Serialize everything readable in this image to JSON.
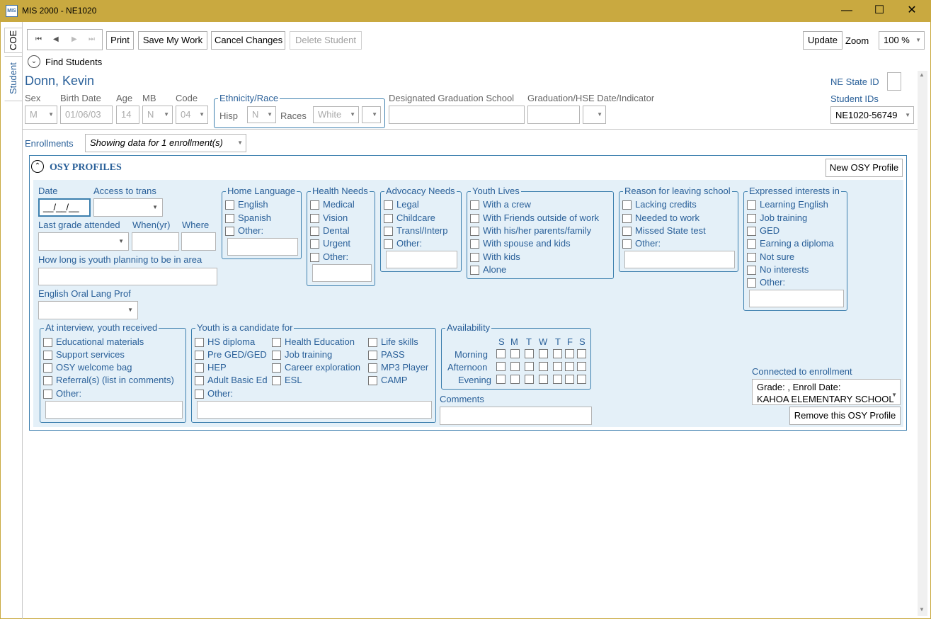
{
  "window": {
    "title": "MIS 2000 - NE1020",
    "app_icon_text": "MIS"
  },
  "side_tabs": [
    "COE",
    "Student"
  ],
  "toolbar": {
    "print": "Print",
    "save": "Save My Work",
    "cancel": "Cancel Changes",
    "delete": "Delete Student",
    "update": "Update",
    "zoom_label": "Zoom",
    "zoom_value": "100 %"
  },
  "find_students": "Find Students",
  "student": {
    "name": "Donn, Kevin",
    "labels": {
      "sex": "Sex",
      "birth_date": "Birth Date",
      "age": "Age",
      "mb": "MB",
      "code": "Code",
      "ethnicity": "Ethnicity/Race",
      "hisp": "Hisp",
      "races": "Races",
      "grad_school": "Designated Graduation School",
      "grad_date": "Graduation/HSE Date/Indicator",
      "ne_state_id": "NE State ID",
      "student_ids": "Student IDs"
    },
    "sex": "M",
    "birth_date": "01/06/03",
    "age": "14",
    "mb": "N",
    "code": "04",
    "hisp": "N",
    "race": "White",
    "student_id": "NE1020-56749"
  },
  "enrollments": {
    "label": "Enrollments",
    "value": "Showing data for 1 enrollment(s)"
  },
  "osy": {
    "title": "OSY PROFILES",
    "new_button": "New OSY Profile",
    "remove_button": "Remove this OSY Profile",
    "date_label": "Date",
    "date_value": "__/__/__",
    "access_label": "Access to trans",
    "last_grade_label": "Last grade attended",
    "when_label": "When(yr)",
    "where_label": "Where",
    "how_long_label": "How long is youth planning to be in area",
    "english_prof_label": "English Oral Lang Prof",
    "home_language": {
      "title": "Home Language",
      "items": [
        "English",
        "Spanish",
        "Other:"
      ]
    },
    "health_needs": {
      "title": "Health Needs",
      "items": [
        "Medical",
        "Vision",
        "Dental",
        "Urgent",
        "Other:"
      ]
    },
    "advocacy_needs": {
      "title": "Advocacy Needs",
      "items": [
        "Legal",
        "Childcare",
        "Transl/Interp",
        "Other:"
      ]
    },
    "youth_lives": {
      "title": "Youth Lives",
      "items": [
        "With a crew",
        "With Friends outside of work",
        "With his/her parents/family",
        "With spouse and kids",
        "With kids",
        "Alone"
      ]
    },
    "reason_leaving": {
      "title": "Reason for leaving school",
      "items": [
        "Lacking credits",
        "Needed to work",
        "Missed State test",
        "Other:"
      ]
    },
    "expressed_interests": {
      "title": "Expressed interests in",
      "items": [
        "Learning English",
        "Job training",
        "GED",
        "Earning a diploma",
        "Not sure",
        "No interests",
        "Other:"
      ]
    },
    "interview_received": {
      "title": "At interview, youth received",
      "items": [
        "Educational materials",
        "Support services",
        "OSY welcome bag",
        "Referral(s) (list in comments)",
        "Other:"
      ]
    },
    "candidate_for": {
      "title": "Youth is a candidate for",
      "col1": [
        "HS diploma",
        "Pre GED/GED",
        "HEP",
        "Adult Basic Ed",
        "Other:"
      ],
      "col2": [
        "Health Education",
        "Job training",
        "Career exploration",
        "ESL"
      ],
      "col3": [
        "Life skills",
        "PASS",
        "MP3 Player",
        "CAMP"
      ]
    },
    "availability": {
      "title": "Availability",
      "days": [
        "S",
        "M",
        "T",
        "W",
        "T",
        "F",
        "S"
      ],
      "rows": [
        "Morning",
        "Afternoon",
        "Evening"
      ]
    },
    "comments_label": "Comments",
    "connected_label": "Connected to enrollment",
    "connected_line1": "Grade: , Enroll Date:",
    "connected_line2": "KAHOA ELEMENTARY SCHOOL"
  }
}
